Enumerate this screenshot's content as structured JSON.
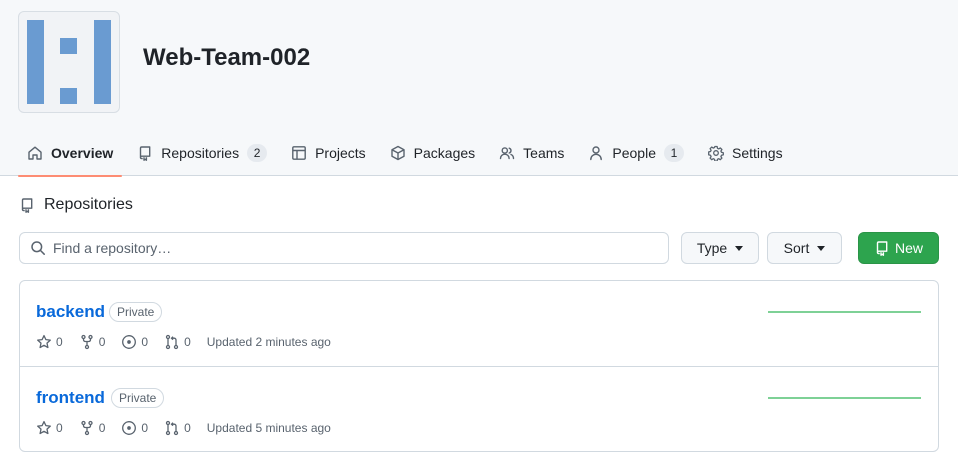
{
  "org": {
    "name": "Web-Team-002",
    "avatar_color": "#6a9bd1"
  },
  "tabs": [
    {
      "label": "Overview",
      "icon": "home-icon",
      "active": true
    },
    {
      "label": "Repositories",
      "icon": "repo-icon",
      "count": "2"
    },
    {
      "label": "Projects",
      "icon": "table-icon"
    },
    {
      "label": "Packages",
      "icon": "package-icon"
    },
    {
      "label": "Teams",
      "icon": "people-icon"
    },
    {
      "label": "People",
      "icon": "person-icon",
      "count": "1"
    },
    {
      "label": "Settings",
      "icon": "gear-icon"
    }
  ],
  "repositories_section": {
    "title": "Repositories",
    "search_placeholder": "Find a repository…",
    "type_label": "Type",
    "sort_label": "Sort",
    "new_label": "New"
  },
  "repos": [
    {
      "name": "backend",
      "visibility": "Private",
      "stars": "0",
      "forks": "0",
      "issues": "0",
      "pulls": "0",
      "updated": "Updated 2 minutes ago"
    },
    {
      "name": "frontend",
      "visibility": "Private",
      "stars": "0",
      "forks": "0",
      "issues": "0",
      "pulls": "0",
      "updated": "Updated 5 minutes ago"
    }
  ],
  "colors": {
    "accent_underline": "#fd8c73",
    "link": "#0969da",
    "new_button": "#2da44e",
    "sparkline": "#7ed196"
  }
}
